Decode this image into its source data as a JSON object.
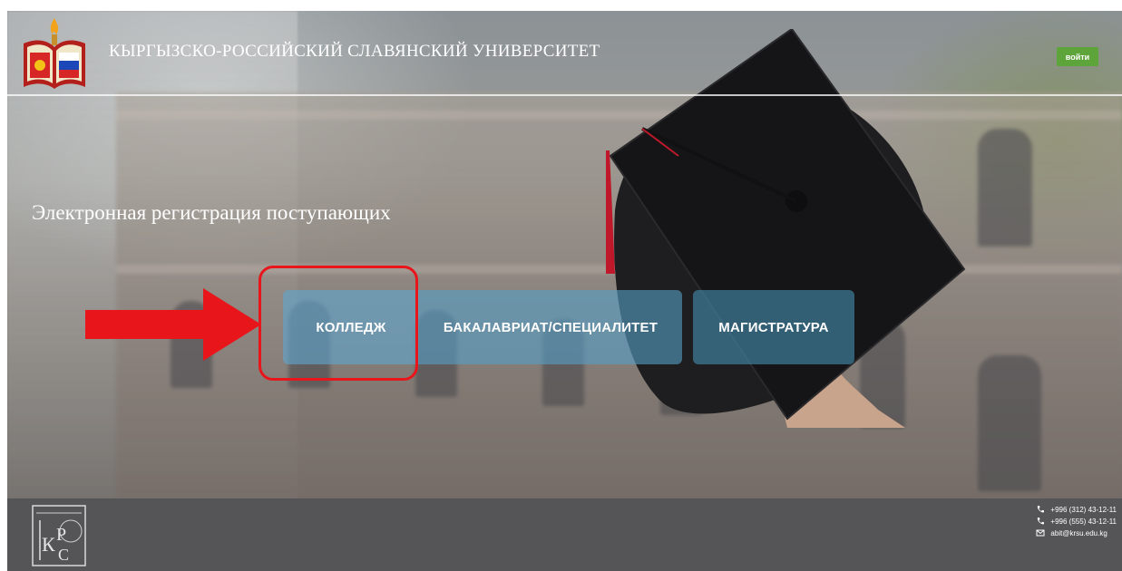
{
  "header": {
    "university_name": "КЫРГЫЗСКО-РОССИЙСКИЙ СЛАВЯНСКИЙ УНИВЕРСИТЕТ",
    "login_label": "войти"
  },
  "hero": {
    "subtitle": "Электронная регистрация поступающих"
  },
  "programs": [
    {
      "label": "КОЛЛЕДЖ"
    },
    {
      "label": "БАКАЛАВРИАТ/СПЕЦИАЛИТЕТ"
    },
    {
      "label": "МАГИСТРАТУРА"
    }
  ],
  "footer": {
    "contacts": [
      {
        "icon": "phone-icon",
        "text": "+996 (312) 43-12-11"
      },
      {
        "icon": "phone-icon",
        "text": "+996 (555) 43-12-11"
      },
      {
        "icon": "mail-icon",
        "text": "abit@krsu.edu.kg"
      }
    ]
  },
  "colors": {
    "login_button": "#5da43a",
    "program_button": "#5096be",
    "annotation": "#e8161b",
    "footer": "#555558"
  }
}
